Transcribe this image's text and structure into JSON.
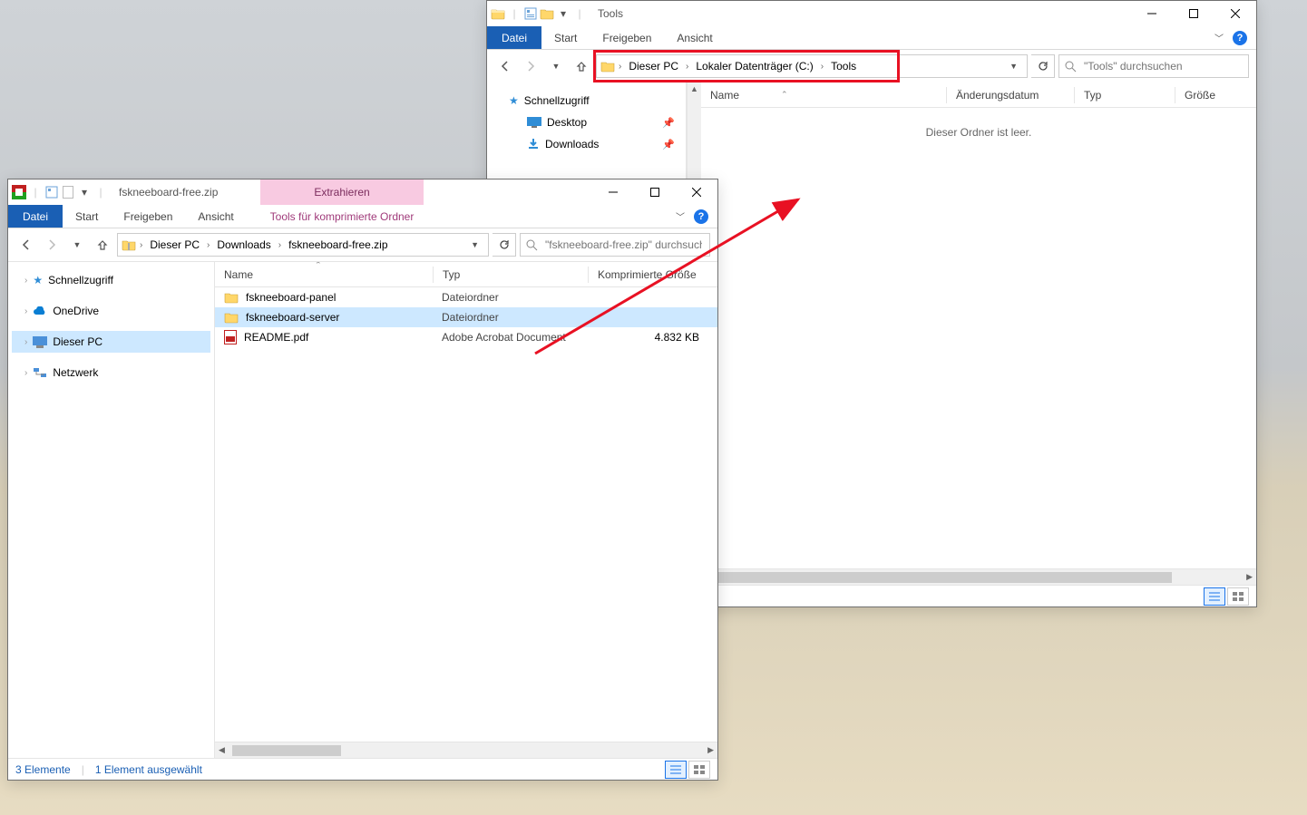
{
  "windowA": {
    "title": "Tools",
    "ribbon": {
      "file": "Datei",
      "tabs": [
        "Start",
        "Freigeben",
        "Ansicht"
      ]
    },
    "breadcrumb": [
      "Dieser PC",
      "Lokaler Datenträger (C:)",
      "Tools"
    ],
    "search_placeholder": "\"Tools\" durchsuchen",
    "columns": {
      "name": "Name",
      "modified": "Änderungsdatum",
      "type": "Typ",
      "size": "Größe"
    },
    "nav": {
      "quick": "Schnellzugriff",
      "items": [
        {
          "label": "Desktop"
        },
        {
          "label": "Downloads"
        }
      ]
    },
    "empty_msg": "Dieser Ordner ist leer."
  },
  "windowB": {
    "title": "fskneeboard-free.zip",
    "context_tab": "Extrahieren",
    "context_sub": "Tools für komprimierte Ordner",
    "ribbon": {
      "file": "Datei",
      "tabs": [
        "Start",
        "Freigeben",
        "Ansicht"
      ]
    },
    "breadcrumb": [
      "Dieser PC",
      "Downloads",
      "fskneeboard-free.zip"
    ],
    "search_placeholder": "\"fskneeboard-free.zip\" durchsuchen",
    "columns": {
      "name": "Name",
      "type": "Typ",
      "csize": "Komprimierte Größe"
    },
    "nav": {
      "quick": "Schnellzugriff",
      "onedrive": "OneDrive",
      "thispc": "Dieser PC",
      "network": "Netzwerk"
    },
    "rows": [
      {
        "name": "fskneeboard-panel",
        "type": "Dateiordner",
        "size": "",
        "kind": "folder"
      },
      {
        "name": "fskneeboard-server",
        "type": "Dateiordner",
        "size": "",
        "kind": "folder",
        "selected": true
      },
      {
        "name": "README.pdf",
        "type": "Adobe Acrobat Document",
        "size": "4.832 KB",
        "kind": "pdf"
      }
    ],
    "status": {
      "count": "3 Elemente",
      "selected": "1 Element ausgewählt"
    }
  }
}
